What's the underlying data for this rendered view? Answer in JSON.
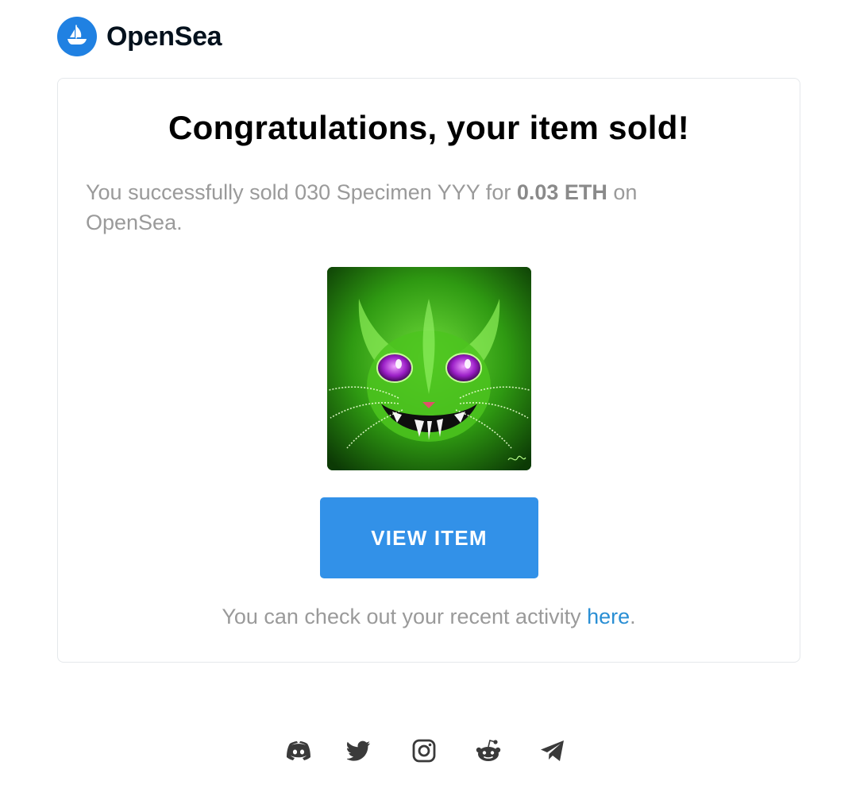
{
  "brand": {
    "name": "OpenSea",
    "logo_icon": "opensea-ship-icon",
    "accent_color": "#2081e2"
  },
  "card": {
    "title": "Congratulations, your item sold!",
    "message_prefix": "You successfully sold 030 Specimen YYY for ",
    "price": "0.03 ETH",
    "message_suffix": " on OpenSea.",
    "image_alt": "030 Specimen YYY",
    "button_label": "VIEW ITEM",
    "button_color": "#3291e8",
    "footer_prefix": "You can check out your recent activity ",
    "footer_link": "here",
    "footer_suffix": "."
  },
  "social": [
    {
      "icon": "discord-icon"
    },
    {
      "icon": "twitter-icon"
    },
    {
      "icon": "instagram-icon"
    },
    {
      "icon": "reddit-icon"
    },
    {
      "icon": "telegram-icon"
    }
  ]
}
